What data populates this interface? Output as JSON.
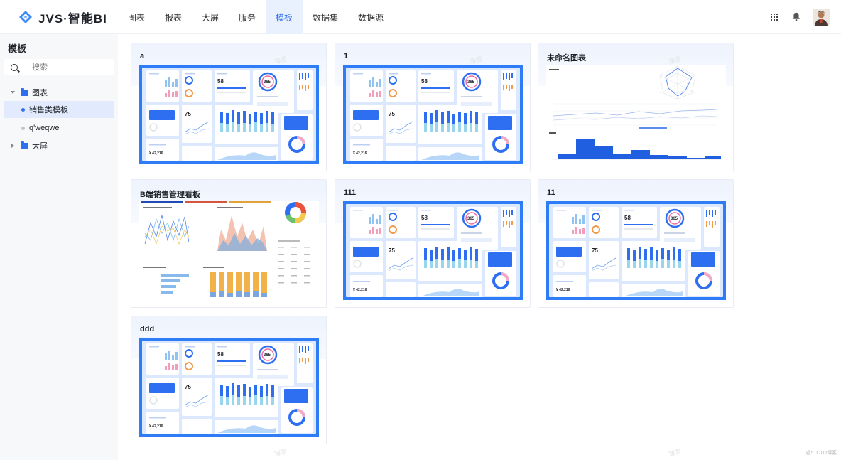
{
  "app": {
    "title": "JVS·智能BI"
  },
  "nav": {
    "items": [
      {
        "label": "图表"
      },
      {
        "label": "报表"
      },
      {
        "label": "大屏"
      },
      {
        "label": "服务"
      },
      {
        "label": "模板"
      },
      {
        "label": "数据集"
      },
      {
        "label": "数据源"
      }
    ],
    "active": "模板"
  },
  "header": {
    "apps_icon": "grid-icon",
    "notification_icon": "bell-icon",
    "avatar_icon": "user-avatar"
  },
  "sidebar": {
    "title": "模板",
    "search": {
      "placeholder": "搜索",
      "value": ""
    },
    "tree": [
      {
        "label": "图表",
        "type": "folder",
        "expanded": true
      },
      {
        "label": "销售类模板",
        "type": "item",
        "selected": true
      },
      {
        "label": "q'weqwe",
        "type": "item",
        "selected": false
      },
      {
        "label": "大屏",
        "type": "folder",
        "expanded": false
      }
    ]
  },
  "templates": [
    {
      "title": "a",
      "thumbnail": "dashboard"
    },
    {
      "title": "1",
      "thumbnail": "dashboard"
    },
    {
      "title": "未命名图表",
      "thumbnail": "charts"
    },
    {
      "title": "B端销售管理看板",
      "thumbnail": "sales-board"
    },
    {
      "title": "111",
      "thumbnail": "dashboard"
    },
    {
      "title": "11",
      "thumbnail": "dashboard"
    },
    {
      "title": "ddd",
      "thumbnail": "dashboard"
    }
  ],
  "watermark": {
    "text": "薄雪"
  },
  "footer": {
    "credit": "@51CTO博客"
  },
  "colors": {
    "accent": "#2e6ff2",
    "active_bg": "#eaf1fe",
    "selected_bg": "#e1ebfd",
    "thumb_blue": "#2e7cf6"
  }
}
